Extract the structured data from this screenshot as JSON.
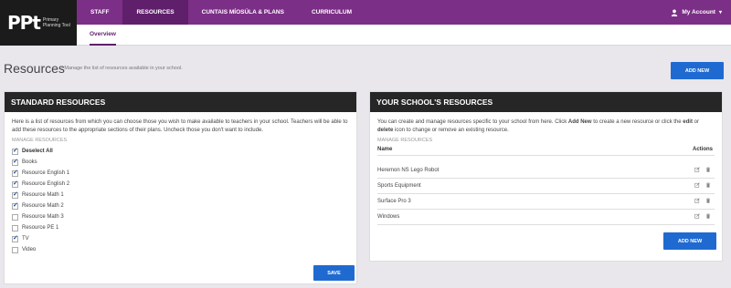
{
  "brand": {
    "mark": "PPt",
    "tagline": "Primary Planning Tool"
  },
  "nav": {
    "items": [
      {
        "label": "STAFF"
      },
      {
        "label": "RESOURCES"
      },
      {
        "label": "CUNTAIS MÍOSÚLA & PLANS"
      },
      {
        "label": "CURRICULUM"
      }
    ],
    "account_label": "My Account"
  },
  "subnav": {
    "tab": "Overview"
  },
  "page": {
    "title": "Resources",
    "subtitle": "- Manage the list of resources available in your school.",
    "add_button": "ADD NEW"
  },
  "standard": {
    "title": "STANDARD RESOURCES",
    "description": "Here is a list of resources from which you can choose those you wish to make available to teachers in your school. Teachers will be able to add these resources to the appropriate sections of their plans. Uncheck those you don't want to include.",
    "section_label": "MANAGE RESOURCES",
    "deselect_label": "Deselect All",
    "items": [
      {
        "label": "Books",
        "checked": true
      },
      {
        "label": "Resource English 1",
        "checked": true
      },
      {
        "label": "Resource English 2",
        "checked": true
      },
      {
        "label": "Resource Math 1",
        "checked": true
      },
      {
        "label": "Resource Math 2",
        "checked": true
      },
      {
        "label": "Resource Math 3",
        "checked": false
      },
      {
        "label": "Resource PE 1",
        "checked": false
      },
      {
        "label": "TV",
        "checked": true
      },
      {
        "label": "Video",
        "checked": false
      }
    ],
    "save_label": "SAVE"
  },
  "school": {
    "title": "YOUR SCHOOL'S RESOURCES",
    "desc_part1": "You can create and manage resources specific to your school from here. Click ",
    "desc_add": "Add New",
    "desc_part2": " to create a new resource or click the ",
    "desc_edit": "edit",
    "desc_or": " or ",
    "desc_delete": "delete",
    "desc_part3": " icon to change or remove an existing resource.",
    "section_label": "MANAGE RESOURCES",
    "col_name": "Name",
    "col_actions": "Actions",
    "rows": [
      {
        "name": "Heremon NS Lego Robot"
      },
      {
        "name": "Sports Equipment"
      },
      {
        "name": "Surface Pro 3"
      },
      {
        "name": "Windows"
      }
    ],
    "add_button": "ADD NEW"
  },
  "icons": {
    "user": "user-icon",
    "chevron": "chevron-down-icon",
    "edit": "edit-icon",
    "delete": "trash-icon",
    "check": "check-icon"
  },
  "colors": {
    "nav_bg": "#7b2f86",
    "nav_active": "#5f1f6b",
    "button": "#1f6ad1",
    "panel_header": "#262626"
  }
}
